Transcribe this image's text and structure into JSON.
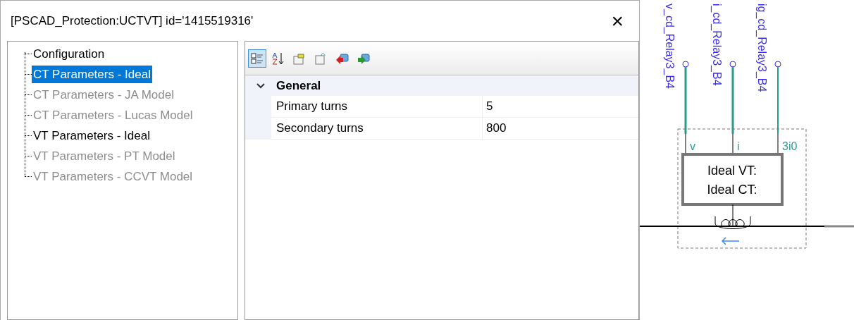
{
  "window": {
    "title": "[PSCAD_Protection:UCTVT] id='1415519316'",
    "close": "×"
  },
  "tree": {
    "items": [
      {
        "label": "Configuration",
        "selected": false,
        "disabled": false
      },
      {
        "label": "CT Parameters - Ideal",
        "selected": true,
        "disabled": false
      },
      {
        "label": "CT Parameters - JA Model",
        "selected": false,
        "disabled": true
      },
      {
        "label": "CT Parameters - Lucas Model",
        "selected": false,
        "disabled": true
      },
      {
        "label": "VT Parameters - Ideal",
        "selected": false,
        "disabled": false
      },
      {
        "label": "VT Parameters - PT Model",
        "selected": false,
        "disabled": true
      },
      {
        "label": "VT Parameters - CCVT Model",
        "selected": false,
        "disabled": true
      }
    ]
  },
  "toolbar": {
    "categorized_selected": true
  },
  "property_grid": {
    "category": "General",
    "expanded": true,
    "rows": [
      {
        "name": "Primary turns",
        "value": "5"
      },
      {
        "name": "Secondary turns",
        "value": "800"
      }
    ]
  },
  "schematic": {
    "signals": [
      {
        "label": "v_cd_Relay3_B4",
        "port": "v"
      },
      {
        "label": "i_cd_Relay3_B4",
        "port": "i"
      },
      {
        "label": "ig_cd_Relay3_B4",
        "port": "3i0"
      }
    ],
    "component_lines": [
      "Ideal VT:",
      "Ideal CT:"
    ]
  }
}
